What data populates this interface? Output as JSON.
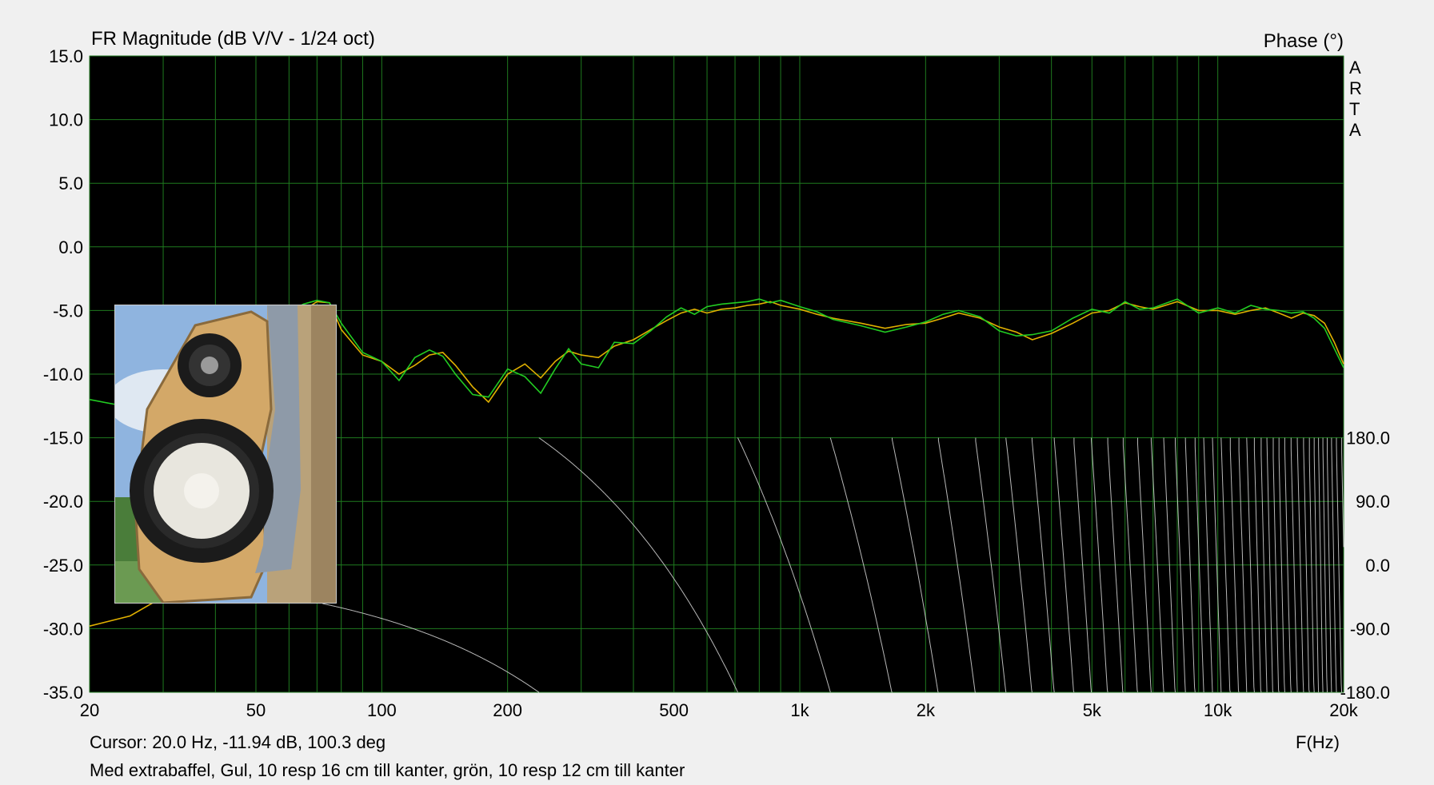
{
  "chart_data": {
    "type": "line",
    "title": "FR Magnitude (dB V/V - 1/24 oct)",
    "right_axis_title": "Phase (°)",
    "watermark": [
      "A",
      "R",
      "T",
      "A"
    ],
    "xlabel": "F(Hz)",
    "x_scale": "log",
    "xlim": [
      20,
      20000
    ],
    "x_ticks": [
      20,
      50,
      100,
      200,
      500,
      1000,
      2000,
      5000,
      10000,
      20000
    ],
    "x_tick_labels": [
      "20",
      "50",
      "100",
      "200",
      "500",
      "1k",
      "2k",
      "5k",
      "10k",
      "20k"
    ],
    "ylim": [
      -35,
      15
    ],
    "y_ticks": [
      15,
      10,
      5,
      0,
      -5,
      -10,
      -15,
      -20,
      -25,
      -30,
      -35
    ],
    "y_tick_labels": [
      "15.0",
      "10.0",
      "5.0",
      "0.0",
      "-5.0",
      "-10.0",
      "-15.0",
      "-20.0",
      "-25.0",
      "-30.0",
      "-35.0"
    ],
    "phase_ylim": [
      -180,
      180
    ],
    "phase_ticks": [
      180,
      90,
      0,
      -90,
      -180
    ],
    "phase_tick_labels": [
      "180.0",
      "90.0",
      "0.0",
      "-90.0",
      "-180.0"
    ],
    "grid": true,
    "colors": {
      "background": "#000000",
      "grid": "#1f7a1f",
      "yellow_series": "#e0b000",
      "green_series": "#22cc22",
      "phase_series": "#d8d8d8"
    },
    "series": [
      {
        "color": "yellow",
        "x": [
          20,
          25,
          30,
          35,
          40,
          45,
          50,
          55,
          60,
          65,
          70,
          75,
          80,
          90,
          100,
          110,
          120,
          130,
          140,
          150,
          165,
          180,
          200,
          220,
          240,
          260,
          280,
          300,
          330,
          360,
          400,
          440,
          480,
          520,
          560,
          600,
          650,
          700,
          750,
          800,
          850,
          900,
          1000,
          1100,
          1200,
          1400,
          1600,
          1800,
          2000,
          2200,
          2400,
          2700,
          3000,
          3300,
          3600,
          4000,
          4500,
          5000,
          5500,
          6000,
          6500,
          7000,
          8000,
          9000,
          10000,
          11000,
          12000,
          13000,
          14000,
          15000,
          16000,
          17000,
          18000,
          19000,
          20000
        ],
        "y": [
          -29.8,
          -29.0,
          -27.5,
          -25.5,
          -22.0,
          -18.0,
          -13.5,
          -9.5,
          -6.5,
          -5.0,
          -4.3,
          -4.4,
          -6.5,
          -8.5,
          -9.0,
          -10.0,
          -9.3,
          -8.5,
          -8.3,
          -9.3,
          -11.0,
          -12.2,
          -10.0,
          -9.2,
          -10.3,
          -9.0,
          -8.2,
          -8.5,
          -8.7,
          -7.8,
          -7.3,
          -6.5,
          -5.8,
          -5.2,
          -4.9,
          -5.2,
          -4.9,
          -4.8,
          -4.6,
          -4.5,
          -4.3,
          -4.6,
          -4.9,
          -5.3,
          -5.6,
          -6.0,
          -6.4,
          -6.1,
          -6.0,
          -5.6,
          -5.2,
          -5.6,
          -6.3,
          -6.7,
          -7.3,
          -6.8,
          -6.0,
          -5.2,
          -5.0,
          -4.4,
          -4.7,
          -4.9,
          -4.3,
          -5.0,
          -5.0,
          -5.3,
          -5.0,
          -4.8,
          -5.2,
          -5.6,
          -5.2,
          -5.4,
          -6.0,
          -7.5,
          -9.2
        ]
      },
      {
        "color": "green",
        "x": [
          20,
          25,
          30,
          35,
          40,
          45,
          50,
          55,
          60,
          65,
          70,
          75,
          80,
          90,
          100,
          110,
          120,
          130,
          140,
          150,
          165,
          180,
          200,
          220,
          240,
          260,
          280,
          300,
          330,
          360,
          400,
          440,
          480,
          520,
          560,
          600,
          650,
          700,
          750,
          800,
          850,
          900,
          1000,
          1100,
          1200,
          1400,
          1600,
          1800,
          2000,
          2200,
          2400,
          2700,
          3000,
          3300,
          3600,
          4000,
          4500,
          5000,
          5500,
          6000,
          6500,
          7000,
          8000,
          9000,
          10000,
          11000,
          12000,
          13000,
          14000,
          15000,
          16000,
          17000,
          18000,
          19000,
          20000
        ],
        "y": [
          -12.0,
          -12.6,
          -12.9,
          -12.6,
          -11.5,
          -10.0,
          -8.3,
          -6.5,
          -5.1,
          -4.5,
          -4.2,
          -4.4,
          -6.0,
          -8.3,
          -9.0,
          -10.5,
          -8.7,
          -8.1,
          -8.6,
          -10.0,
          -11.6,
          -11.8,
          -9.6,
          -10.2,
          -11.5,
          -9.6,
          -8.0,
          -9.2,
          -9.5,
          -7.5,
          -7.6,
          -6.6,
          -5.5,
          -4.8,
          -5.3,
          -4.7,
          -4.5,
          -4.4,
          -4.3,
          -4.1,
          -4.4,
          -4.2,
          -4.7,
          -5.1,
          -5.7,
          -6.2,
          -6.7,
          -6.3,
          -5.9,
          -5.3,
          -5.0,
          -5.5,
          -6.6,
          -7.0,
          -6.9,
          -6.6,
          -5.6,
          -4.9,
          -5.2,
          -4.3,
          -4.9,
          -4.8,
          -4.1,
          -5.2,
          -4.8,
          -5.2,
          -4.6,
          -4.9,
          -5.0,
          -5.2,
          -5.1,
          -5.6,
          -6.4,
          -8.0,
          -9.5
        ]
      }
    ],
    "phase": {
      "x_start": 20,
      "x_end": 20000,
      "note_shape": "wrapping sawtooth (-180 to 180) becoming dense at high frequency"
    },
    "cursor_readout": "Cursor: 20.0 Hz, -11.94 dB, 100.3 deg",
    "caption": "Med extrabaffel, Gul, 10 resp 16 cm till kanter, grön, 10 resp 12 cm till kanter"
  },
  "photo": {
    "description_icon": "speaker-cabinet-photo",
    "colors": {
      "sky": "#8fb4df",
      "wood": "#d3a868",
      "driver": "#1b1b1b",
      "cone": "#e8e6de",
      "tape": "#8e9aa8"
    }
  }
}
